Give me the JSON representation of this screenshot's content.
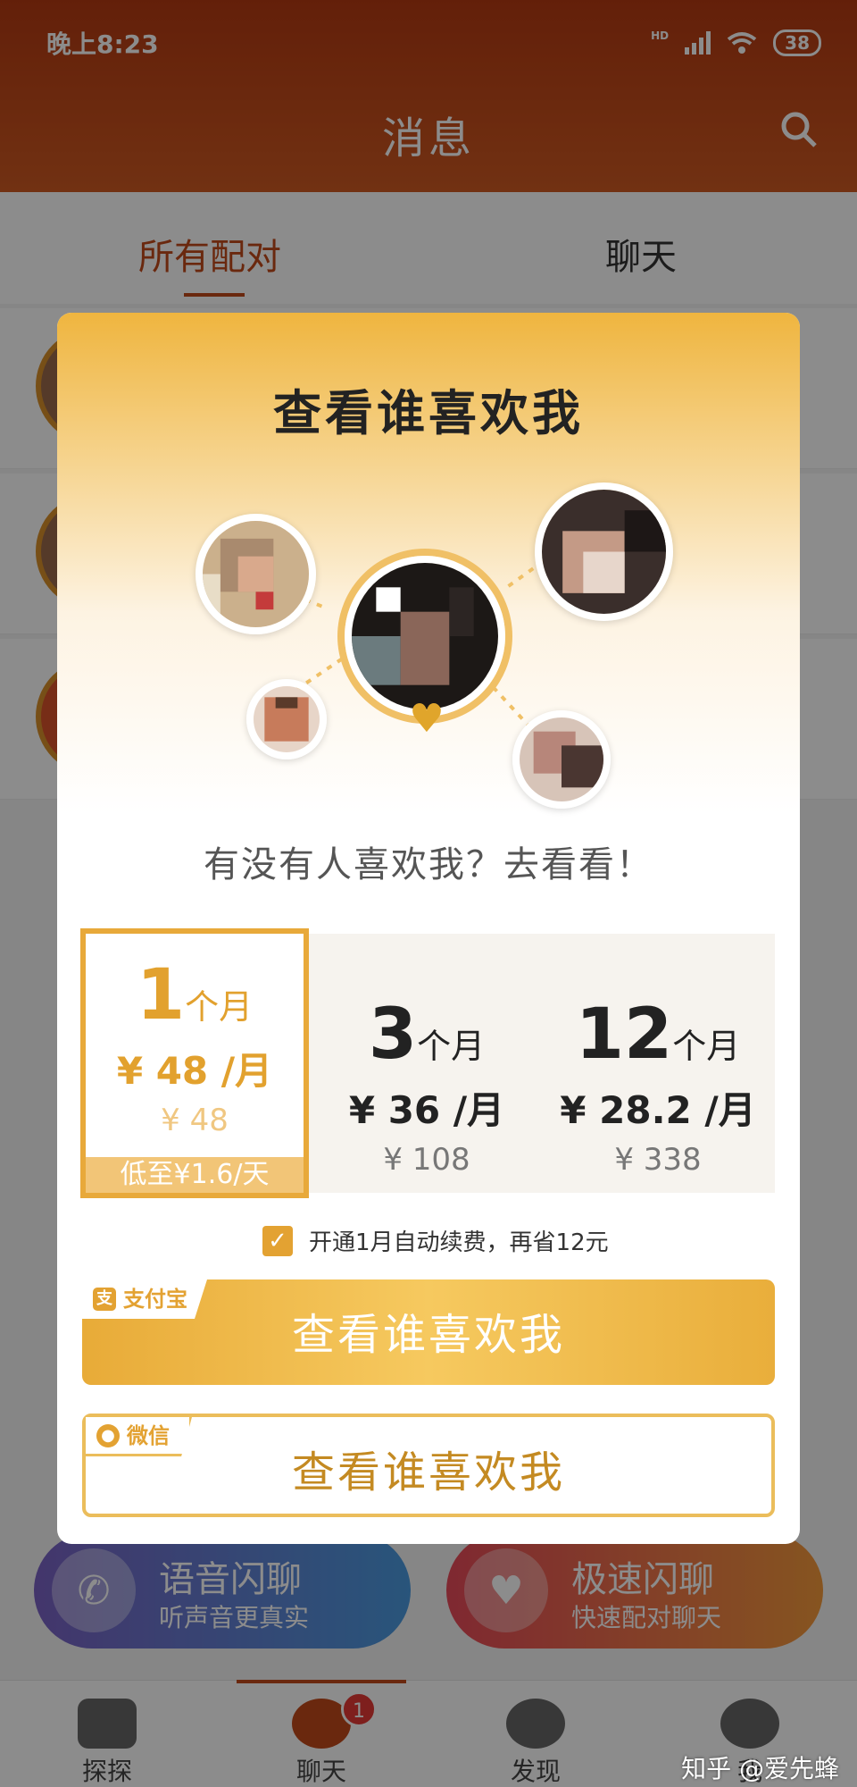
{
  "status_bar": {
    "time": "晚上8:23",
    "network": "HD",
    "battery": "38"
  },
  "header": {
    "title": "消息"
  },
  "tabs": [
    {
      "label": "所有配对"
    },
    {
      "label": "聊天"
    }
  ],
  "quick_actions": [
    {
      "title": "语音闪聊",
      "subtitle": "听声音更真实",
      "icon": "phone-icon"
    },
    {
      "title": "极速闪聊",
      "subtitle": "快速配对聊天",
      "icon": "heart-chat-icon"
    }
  ],
  "bottom_nav": [
    {
      "label": "探探"
    },
    {
      "label": "聊天",
      "badge": "1"
    },
    {
      "label": "发现"
    },
    {
      "label": "我"
    }
  ],
  "watermark": "知乎 @爱先蜂",
  "modal": {
    "title": "查看谁喜欢我",
    "question": "有没有人喜欢我？去看看！",
    "plans": [
      {
        "num": "1",
        "unit": "个月",
        "price": "¥ 48 /月",
        "original": "¥ 48",
        "daily": "低至¥1.6/天",
        "selected": true
      },
      {
        "num": "3",
        "unit": "个月",
        "price": "¥ 36 /月",
        "original": "¥ 108"
      },
      {
        "num": "12",
        "unit": "个月",
        "price": "¥ 28.2 /月",
        "original": "¥ 338"
      }
    ],
    "auto_renew": {
      "label": "开通1月自动续费，再省12元",
      "checked": true
    },
    "pay_alipay": {
      "tag": "支付宝",
      "label": "查看谁喜欢我"
    },
    "pay_wechat": {
      "tag": "微信",
      "label": "查看谁喜欢我"
    }
  },
  "colors": {
    "accent": "#e3a232",
    "header": "#c24a1a"
  }
}
